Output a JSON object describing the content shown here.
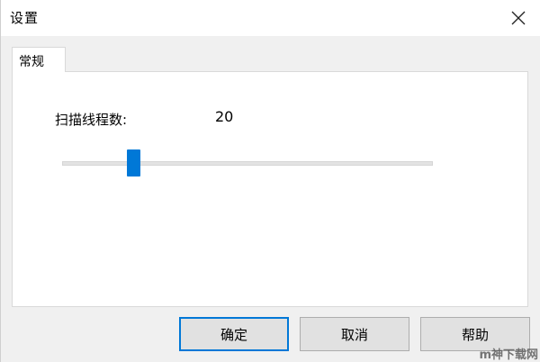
{
  "window": {
    "title": "设置",
    "close_icon": "close-icon"
  },
  "tabs": [
    {
      "label": "常规",
      "selected": true
    }
  ],
  "general": {
    "thread_label": "扫描线程数:",
    "thread_value": "20",
    "slider": {
      "min": 1,
      "max": 100,
      "value": 20
    }
  },
  "buttons": {
    "ok": "确定",
    "cancel": "取消",
    "help": "帮助"
  },
  "watermark": "m神下载网",
  "colors": {
    "accent": "#0078d7",
    "button_bg": "#e1e1e1",
    "window_bg": "#f0f0f0"
  }
}
